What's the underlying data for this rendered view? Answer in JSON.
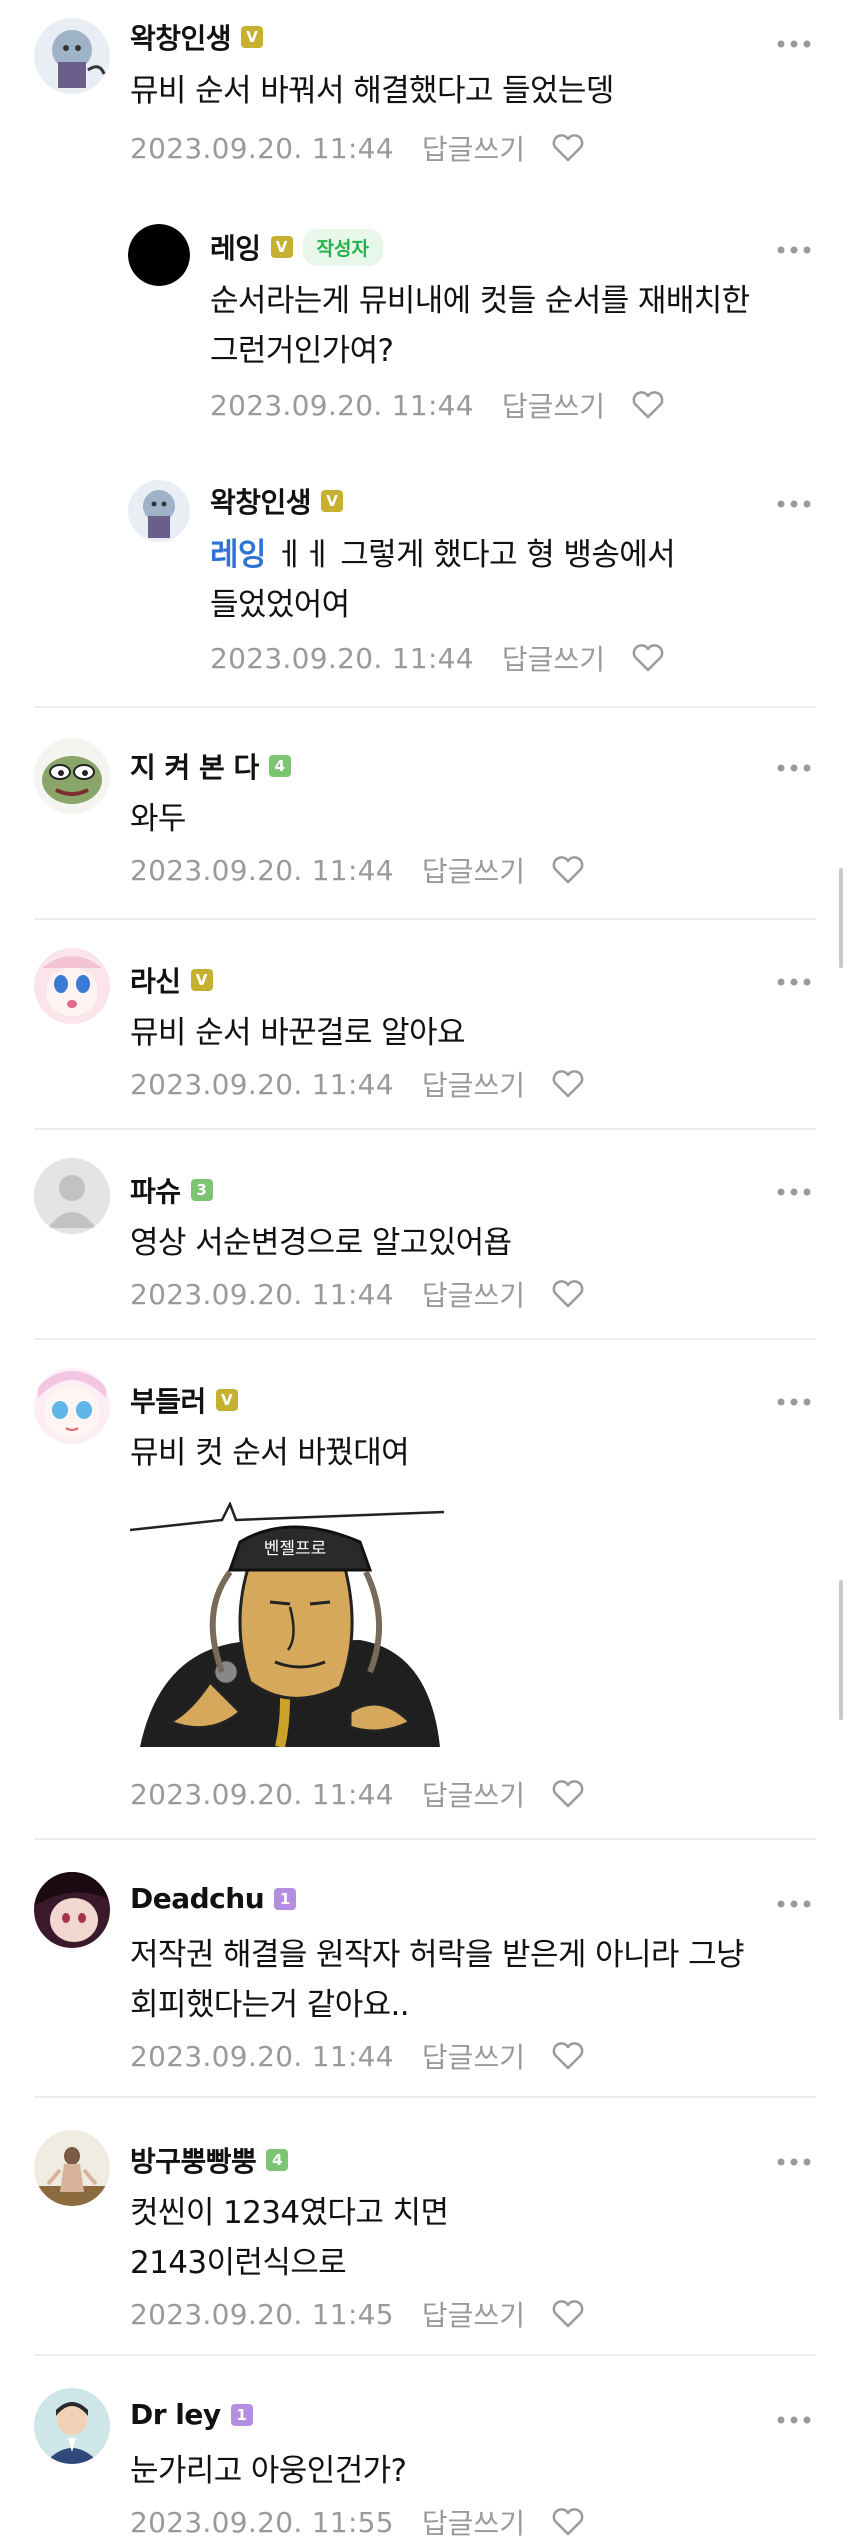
{
  "comments": [
    {
      "nickname": "왁창인생",
      "level": "V",
      "text": "뮤비 순서 바꿔서 해결했다고 들었는뎅",
      "date": "2023.09.20. 11:44",
      "reply_label": "답글쓰기"
    },
    {
      "nickname": "레잉",
      "level": "V",
      "author_badge": "작성자",
      "text": "순서라는게 뮤비내에 컷들 순서를 재배치한 그런거인가여?",
      "date": "2023.09.20. 11:44",
      "reply_label": "답글쓰기"
    },
    {
      "nickname": "왁창인생",
      "level": "V",
      "mention": "레잉",
      "text": " ㅔㅔ 그렇게 했다고 형 뱅송에서 들었었어여",
      "date": "2023.09.20. 11:44",
      "reply_label": "답글쓰기"
    },
    {
      "nickname": "지 켜 본 다",
      "level": "4",
      "text": "와두",
      "date": "2023.09.20. 11:44",
      "reply_label": "답글쓰기"
    },
    {
      "nickname": "라신",
      "level": "V",
      "text": "뮤비 순서 바꾼걸로 알아요",
      "date": "2023.09.20. 11:44",
      "reply_label": "답글쓰기"
    },
    {
      "nickname": "파슈",
      "level": "3",
      "text": "영상 서순변경으로 알고있어욥",
      "date": "2023.09.20. 11:44",
      "reply_label": "답글쓰기"
    },
    {
      "nickname": "부들러",
      "level": "V",
      "text": "뮤비 컷 순서 바꿨대여",
      "sticker_text": "벤젤프로",
      "date": "2023.09.20. 11:44",
      "reply_label": "답글쓰기"
    },
    {
      "nickname": "Deadchu",
      "level": "1",
      "text": "저작권 해결을 원작자 허락을 받은게 아니라 그냥 회피했다는거 같아요..",
      "date": "2023.09.20. 11:44",
      "reply_label": "답글쓰기"
    },
    {
      "nickname": "방구뿡빵뿡",
      "level": "4",
      "text": "컷씬이 1234였다고 치면\n2143이런식으로",
      "date": "2023.09.20. 11:45",
      "reply_label": "답글쓰기"
    },
    {
      "nickname": "Dr ley",
      "level": "1",
      "text": "눈가리고 아웅인건가?",
      "date": "2023.09.20. 11:55",
      "reply_label": "답글쓰기"
    }
  ],
  "colors": {
    "level_v": "#c5b12f",
    "level_green": "#7cc472",
    "level_purple": "#b48ee0",
    "mention": "#2d74d6",
    "author_badge": "#25b24a"
  },
  "icons": {
    "more": "more-dots-icon",
    "like": "heart-outline-icon"
  }
}
